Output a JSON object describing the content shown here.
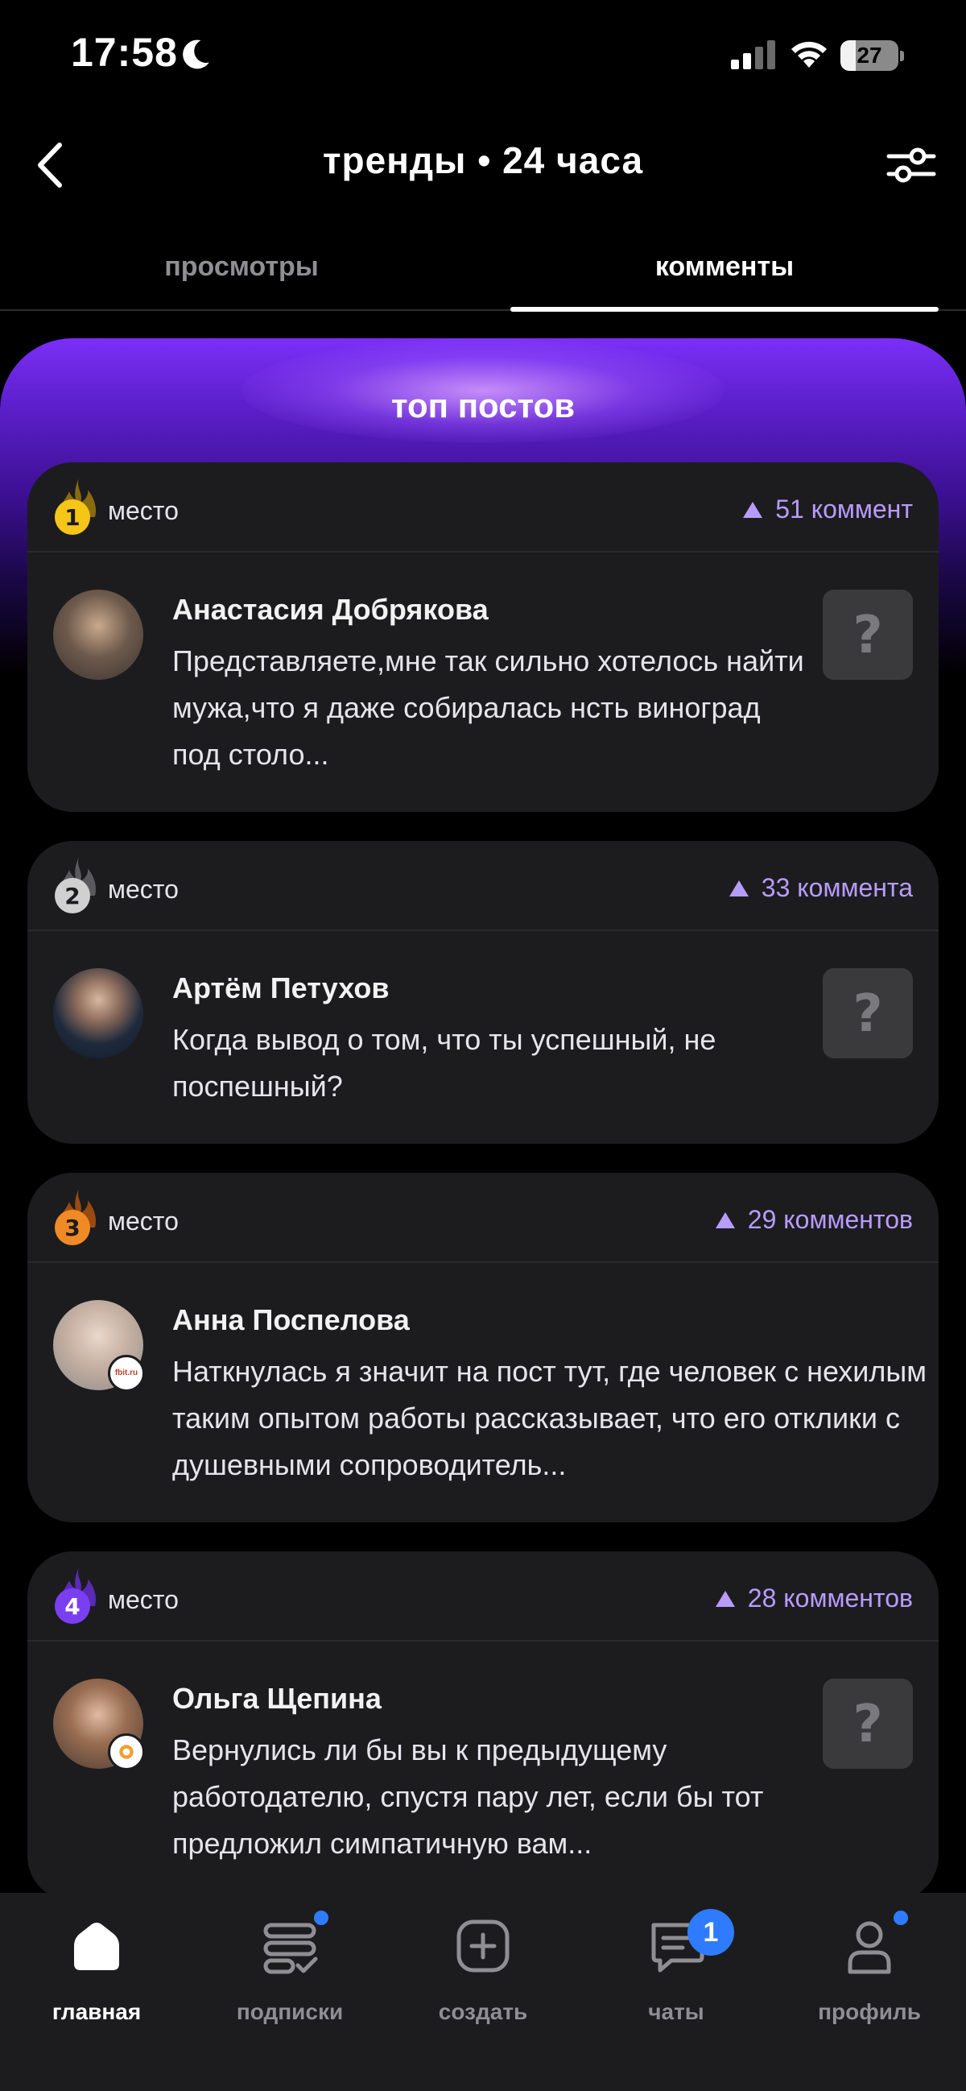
{
  "status_bar": {
    "time": "17:58",
    "battery": "27",
    "battery_level": 0.27
  },
  "header": {
    "title": "тренды • 24 часа"
  },
  "tabs": [
    {
      "label": "просмотры",
      "active": false
    },
    {
      "label": "комменты",
      "active": true
    }
  ],
  "panel": {
    "title": "топ постов"
  },
  "posts": [
    {
      "rank": "1",
      "place_label": "место",
      "comments": "51 коммент",
      "author": "Анастасия Добрякова",
      "text": "Представляете,мне так сильно хотелось найти мужа,что я даже собиралась нсть виноград под столо...",
      "has_thumbnail": true
    },
    {
      "rank": "2",
      "place_label": "место",
      "comments": "33 коммента",
      "author": "Артём Петухов",
      "text": "Когда вывод о том, что ты успешный, не поспешный?",
      "has_thumbnail": true
    },
    {
      "rank": "3",
      "place_label": "место",
      "comments": "29 комментов",
      "author": "Анна Поспелова",
      "text": "Наткнулась я значит на пост тут, где человек с нехилым таким опытом работы рассказывает, что его отклики с душевными сопроводитель...",
      "has_thumbnail": false,
      "avatar_badge": "fbit.ru"
    },
    {
      "rank": "4",
      "place_label": "место",
      "comments": "28 комментов",
      "author": "Ольга Щепина",
      "text": "Вернулись ли бы вы к предыдущему работодателю, спустя пару лет, если бы тот предложил симпатичную вам...",
      "has_thumbnail": true
    }
  ],
  "rank_colors": {
    "1": "#f5c518",
    "2": "#d0d0d0",
    "3": "#f08a24",
    "4": "#7b3ff2"
  },
  "nav": [
    {
      "label": "главная",
      "icon": "home-icon",
      "active": true
    },
    {
      "label": "подписки",
      "icon": "subscriptions-icon",
      "active": false,
      "dot": true
    },
    {
      "label": "создать",
      "icon": "plus-square-icon",
      "active": false
    },
    {
      "label": "чаты",
      "icon": "chat-icon",
      "active": false,
      "badge": "1"
    },
    {
      "label": "профиль",
      "icon": "profile-icon",
      "active": false,
      "dot": true
    }
  ]
}
